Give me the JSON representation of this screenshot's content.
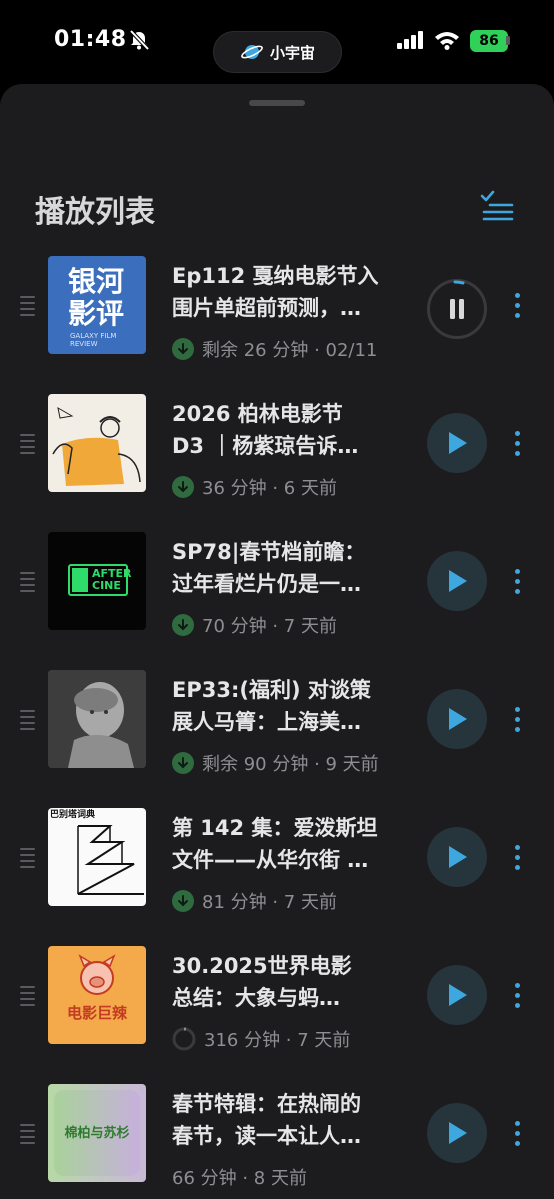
{
  "status": {
    "time": "01:48",
    "battery": "86",
    "island_label": "小宇宙"
  },
  "sheet": {
    "title": "播放列表"
  },
  "episodes": [
    {
      "title_line1": "Ep112 戛纳电影节入",
      "title_line2": "围片单超前预测，…",
      "meta": "剩余 26 分钟 · 02/11",
      "cover_text1": "银河",
      "cover_text2": "影评",
      "cover_sub": "GALAXY FILM REVIEW",
      "state": "playing"
    },
    {
      "title_line1": "2026 柏林电影节",
      "title_line2": "D3 ｜杨紫琼告诉…",
      "meta": "36 分钟 · 6 天前",
      "state": "paused"
    },
    {
      "title_line1": "SP78|春节档前瞻：",
      "title_line2": "过年看烂片仍是一…",
      "meta": "70 分钟 · 7 天前",
      "cover_text1": "AFTER",
      "cover_text2": "CINE",
      "state": "paused"
    },
    {
      "title_line1": "EP33:(福利) 对谈策",
      "title_line2": "展人马箐：上海美…",
      "meta": "剩余 90 分钟 · 9 天前",
      "state": "paused"
    },
    {
      "title_line1": "第 142 集：爱泼斯坦",
      "title_line2": "文件——从华尔街 …",
      "meta": "81 分钟 · 7 天前",
      "cover_text1": "巴别塔词典",
      "state": "paused"
    },
    {
      "title_line1": "30.2025世界电影",
      "title_line2": "总结：大象与蚂…",
      "meta": "316 分钟 · 7 天前",
      "cover_text1": "电影巨辣",
      "state": "paused"
    },
    {
      "title_line1": "春节特辑：在热闹的",
      "title_line2": "春节，读一本让人…",
      "meta": "66 分钟 · 8 天前",
      "cover_text1": "棉柏与苏杉",
      "state": "paused"
    }
  ],
  "colors": {
    "accent": "#3fa7e0",
    "download": "#30d158",
    "sheet_bg": "#1c1c1e"
  }
}
